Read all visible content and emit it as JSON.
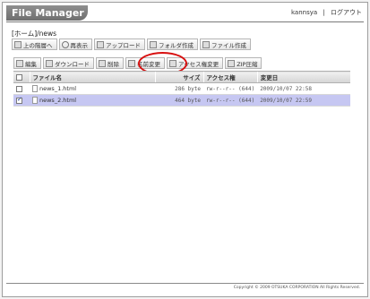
{
  "app_title": "File Manager",
  "header": {
    "username": "kannsya",
    "separator": "|",
    "logout": "ログアウト"
  },
  "breadcrumb": "[ホーム]/news",
  "toolbar_row1": [
    {
      "label": "上の階層へ",
      "icon": "up-folder-icon"
    },
    {
      "label": "再表示",
      "icon": "refresh-icon"
    },
    {
      "label": "アップロード",
      "icon": "upload-icon"
    },
    {
      "label": "フォルダ作成",
      "icon": "folder-create-icon"
    },
    {
      "label": "ファイル作成",
      "icon": "file-create-icon"
    }
  ],
  "toolbar_row2": [
    {
      "label": "編集",
      "icon": "edit-icon"
    },
    {
      "label": "ダウンロード",
      "icon": "download-icon"
    },
    {
      "label": "削除",
      "icon": "delete-icon"
    },
    {
      "label": "名前変更",
      "icon": "rename-icon"
    },
    {
      "label": "アクセス権変更",
      "icon": "permission-icon"
    },
    {
      "label": "ZIP圧縮",
      "icon": "zip-icon"
    }
  ],
  "table": {
    "columns": [
      "ファイル名",
      "サイズ",
      "アクセス権",
      "変更日"
    ],
    "rows": [
      {
        "name": "news_1.html",
        "size": "286 byte",
        "perm": "rw-r--r-- (644)",
        "date": "2009/10/07 22:58",
        "checked": false
      },
      {
        "name": "news_2.html",
        "size": "464 byte",
        "perm": "rw-r--r-- (644)",
        "date": "2009/10/07 22:59",
        "checked": true
      }
    ]
  },
  "footer": "Copyright © 2009 OTSUKA CORPORATION All Rights Reserved.",
  "colors": {
    "title_bar": "#7f7f7f",
    "selected_row": "#c6c7f2",
    "highlight_circle": "#d81010"
  }
}
